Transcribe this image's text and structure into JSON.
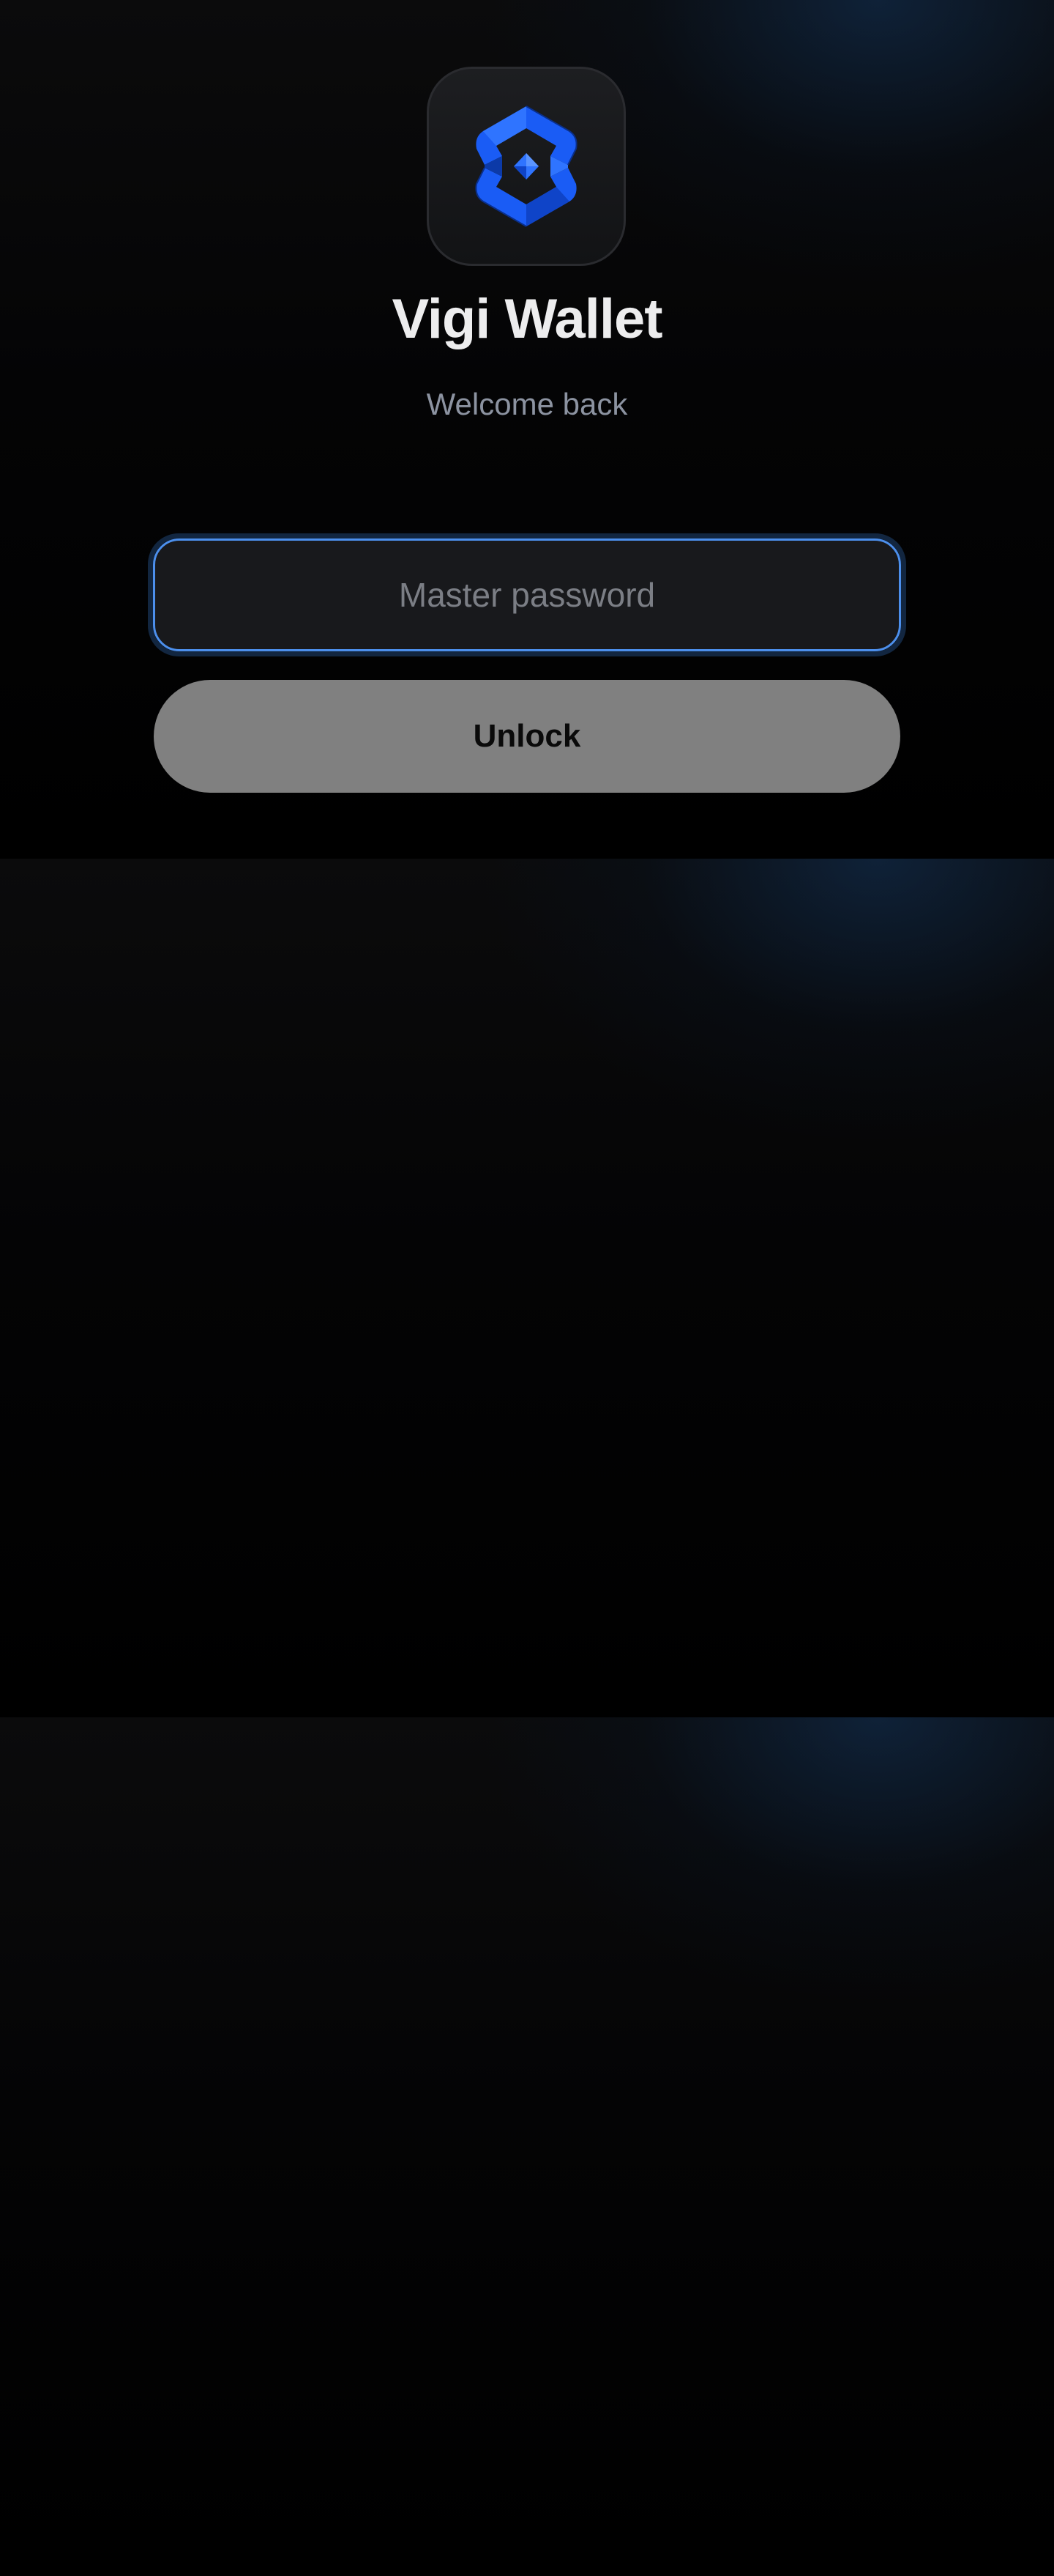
{
  "app": {
    "title": "Vigi Wallet",
    "subtitle": "Welcome back",
    "logo_icon": "vigi-wallet-logo-icon",
    "brand_color": "#1a5cf5"
  },
  "unlock_form": {
    "password_placeholder": "Master password",
    "password_value": "",
    "unlock_label": "Unlock",
    "focus_color": "#4c8fec"
  }
}
